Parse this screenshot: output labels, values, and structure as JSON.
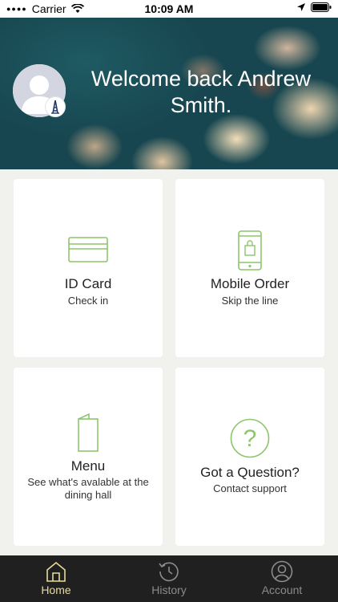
{
  "status_bar": {
    "carrier": "Carrier",
    "time": "10:09 AM"
  },
  "header": {
    "welcome": "Welcome back Andrew Smith."
  },
  "cards": [
    {
      "title": "ID Card",
      "subtitle": "Check in",
      "icon": "id-card-icon"
    },
    {
      "title": "Mobile Order",
      "subtitle": "Skip the line",
      "icon": "mobile-bag-icon"
    },
    {
      "title": "Menu",
      "subtitle": "See what's avalable at the dining hall",
      "icon": "menu-icon"
    },
    {
      "title": "Got a Question?",
      "subtitle": "Contact support",
      "icon": "question-circle-icon"
    }
  ],
  "tabs": [
    {
      "label": "Home",
      "icon": "home-icon",
      "active": true
    },
    {
      "label": "History",
      "icon": "history-icon",
      "active": false
    },
    {
      "label": "Account",
      "icon": "account-icon",
      "active": false
    }
  ],
  "colors": {
    "accent": "#8cc66a",
    "tab_active": "#e8dc9a",
    "tab_inactive": "#8b8b8b",
    "tabbar_bg": "#202020",
    "page_bg": "#f1f1ee"
  }
}
